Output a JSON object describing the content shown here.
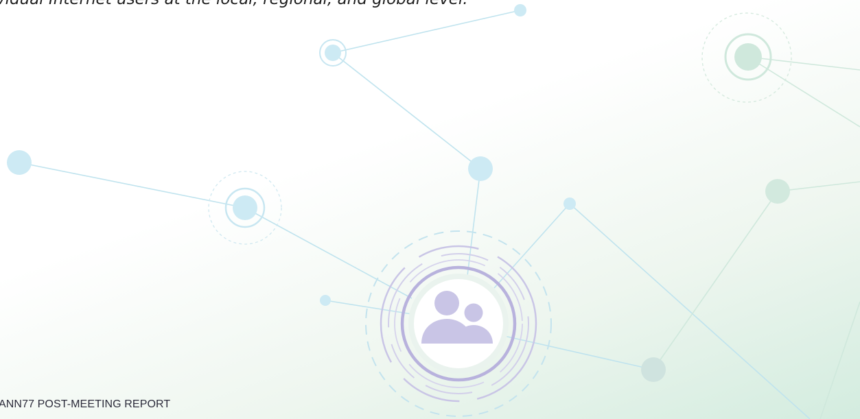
{
  "intro": {
    "text_fragment": "vidual Internet users at the local, regional, and global level."
  },
  "footer": {
    "report_label": "ANN77 POST-MEETING REPORT"
  },
  "colors": {
    "node_fill": "#cdeaf4",
    "link_stroke": "#bfe3ee",
    "accent_purple": "#c9c5e6",
    "ring_purple": "#b8b2dd",
    "green_node": "#cfe8dc"
  },
  "icons": {
    "center": "people-group-icon"
  }
}
